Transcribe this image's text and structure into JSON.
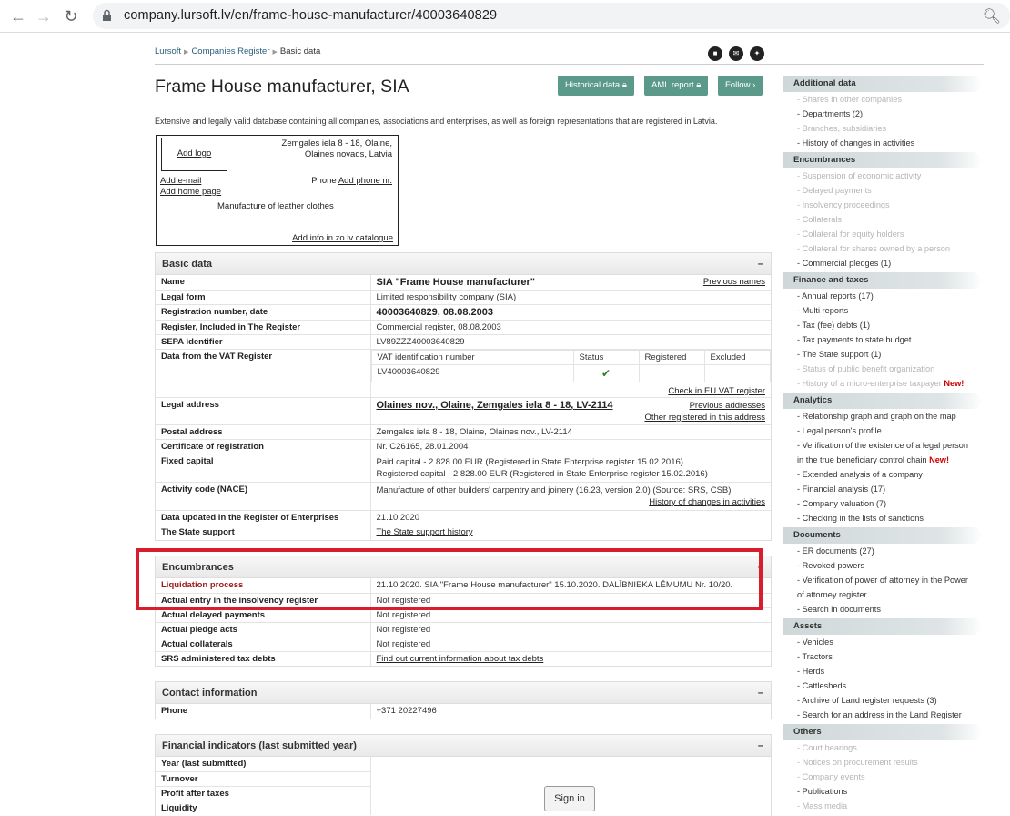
{
  "browser": {
    "url": "company.lursoft.lv/en/frame-house-manufacturer/40003640829"
  },
  "breadcrumb": [
    "Lursoft",
    "Companies Register",
    "Basic data"
  ],
  "title": "Frame House manufacturer, SIA",
  "buttons": {
    "historical": "Historical data",
    "aml": "AML report",
    "follow": "Follow"
  },
  "intro": "Extensive and legally valid database containing all companies, associations and enterprises, as well as foreign representations that are registered in Latvia.",
  "card": {
    "add_logo": "Add logo",
    "address_line1": "Zemgales iela 8 - 18, Olaine,",
    "address_line2": "Olaines novads, Latvia",
    "add_email": "Add e-mail",
    "add_home": "Add home page",
    "phone_label": "Phone",
    "add_phone": "Add phone nr.",
    "activity": "Manufacture of leather clothes",
    "add_info": "Add info in zo.lv catalogue"
  },
  "basic": {
    "header": "Basic data",
    "name_k": "Name",
    "name_v": "SIA \"Frame House manufacturer\"",
    "prev_names": "Previous names",
    "form_k": "Legal form",
    "form_v": "Limited responsibility company (SIA)",
    "reg_k": "Registration number, date",
    "reg_v": "40003640829, 08.08.2003",
    "regin_k": "Register, Included in The Register",
    "regin_v": "Commercial register, 08.08.2003",
    "sepa_k": "SEPA identifier",
    "sepa_v": "LV89ZZZ40003640829",
    "vat_k": "Data from the VAT Register",
    "vat_h1": "VAT identification number",
    "vat_h2": "Status",
    "vat_h3": "Registered",
    "vat_h4": "Excluded",
    "vat_v": "LV40003640829",
    "vat_check": "Check in EU VAT register",
    "laddr_k": "Legal address",
    "laddr_v": "Olaines nov., Olaine, Zemgales iela 8 - 18, LV-2114",
    "prev_addr": "Previous addresses",
    "other_reg": "Other registered in this address",
    "paddr_k": "Postal address",
    "paddr_v": "Zemgales iela 8 - 18, Olaine, Olaines nov., LV-2114",
    "cert_k": "Certificate of registration",
    "cert_v": "Nr. C26165, 28.01.2004",
    "cap_k": "Fixed capital",
    "cap_v1": "Paid capital - 2 828.00 EUR (Registered in State Enterprise register 15.02.2016)",
    "cap_v2": "Registered capital - 2 828.00 EUR (Registered in State Enterprise register 15.02.2016)",
    "nace_k": "Activity code (NACE)",
    "nace_v": "Manufacture of other builders' carpentry and joinery (16.23, version 2.0) (Source: SRS, CSB)",
    "nace_hist": "History of changes in activities",
    "upd_k": "Data updated in the Register of Enterprises",
    "upd_v": "21.10.2020",
    "sup_k": "The State support",
    "sup_v": "The State support history"
  },
  "enc": {
    "header": "Encumbrances",
    "liq_k": "Liquidation process",
    "liq_v": "21.10.2020. SIA \"Frame House manufacturer\" 15.10.2020. DALĪBNIEKA LĒMUMU Nr. 10/20.",
    "ins_k": "Actual entry in the insolvency register",
    "ins_v": "Not registered",
    "del_k": "Actual delayed payments",
    "del_v": "Not registered",
    "pl_k": "Actual pledge acts",
    "pl_v": "Not registered",
    "col_k": "Actual collaterals",
    "col_v": "Not registered",
    "srs_k": "SRS administered tax debts",
    "srs_v": "Find out current information about tax debts"
  },
  "contact": {
    "header": "Contact information",
    "phone_k": "Phone",
    "phone_v": "+371 20227496"
  },
  "fin": {
    "header": "Financial indicators (last submitted year)",
    "rows": [
      "Year (last submitted)",
      "Turnover",
      "Profit after taxes",
      "Liquidity"
    ],
    "signin": "Sign in"
  },
  "sidebar": [
    {
      "h": "Additional data",
      "items": [
        {
          "t": "Shares in other companies",
          "g": true
        },
        {
          "t": "Departments (2)",
          "g": false
        },
        {
          "t": "Branches, subsidiaries",
          "g": true
        },
        {
          "t": "History of changes in activities",
          "g": false
        }
      ]
    },
    {
      "h": "Encumbrances",
      "items": [
        {
          "t": "Suspension of economic activity",
          "g": true
        },
        {
          "t": "Delayed payments",
          "g": true
        },
        {
          "t": "Insolvency proceedings",
          "g": true
        },
        {
          "t": "Collaterals",
          "g": true
        },
        {
          "t": "Collateral for equity holders",
          "g": true
        },
        {
          "t": "Collateral for shares owned by a person",
          "g": true
        },
        {
          "t": "Commercial pledges (1)",
          "g": false
        }
      ]
    },
    {
      "h": "Finance and taxes",
      "items": [
        {
          "t": "Annual reports (17)",
          "g": false
        },
        {
          "t": "Multi reports",
          "g": false
        },
        {
          "t": "Tax (fee) debts (1)",
          "g": false
        },
        {
          "t": "Tax payments to state budget",
          "g": false
        },
        {
          "t": "The State support (1)",
          "g": false
        },
        {
          "t": "Status of public benefit organization",
          "g": true
        },
        {
          "t": "History of a micro-enterprise taxpayer",
          "g": true,
          "new": "New!"
        }
      ]
    },
    {
      "h": "Analytics",
      "items": [
        {
          "t": "Relationship graph and graph on the map",
          "g": false
        },
        {
          "t": "Legal person's profile",
          "g": false
        },
        {
          "t": "Verification of the existence of a legal person",
          "g": false
        },
        {
          "t": "in the true beneficiary control chain",
          "g": false,
          "cont": true,
          "new": "New!"
        },
        {
          "t": "Extended analysis of a company",
          "g": false
        },
        {
          "t": "Financial analysis (17)",
          "g": false
        },
        {
          "t": "Company valuation (7)",
          "g": false
        },
        {
          "t": "Checking in the lists of sanctions",
          "g": false
        }
      ]
    },
    {
      "h": "Documents",
      "items": [
        {
          "t": "ER documents (27)",
          "g": false
        },
        {
          "t": "Revoked powers",
          "g": false
        },
        {
          "t": "Verification of power of attorney in the Power",
          "g": false
        },
        {
          "t": "of attorney register",
          "g": false,
          "cont": true
        },
        {
          "t": "Search in documents",
          "g": false
        }
      ]
    },
    {
      "h": "Assets",
      "items": [
        {
          "t": "Vehicles",
          "g": false
        },
        {
          "t": "Tractors",
          "g": false
        },
        {
          "t": "Herds",
          "g": false
        },
        {
          "t": "Cattlesheds",
          "g": false
        },
        {
          "t": "Archive of Land register requests (3)",
          "g": false
        },
        {
          "t": "Search for an address in the Land Register",
          "g": false
        }
      ]
    },
    {
      "h": "Others",
      "items": [
        {
          "t": "Court hearings",
          "g": true
        },
        {
          "t": "Notices on procurement results",
          "g": true
        },
        {
          "t": "Company events",
          "g": true
        },
        {
          "t": "Publications",
          "g": false
        },
        {
          "t": "Mass media",
          "g": true
        }
      ]
    }
  ]
}
